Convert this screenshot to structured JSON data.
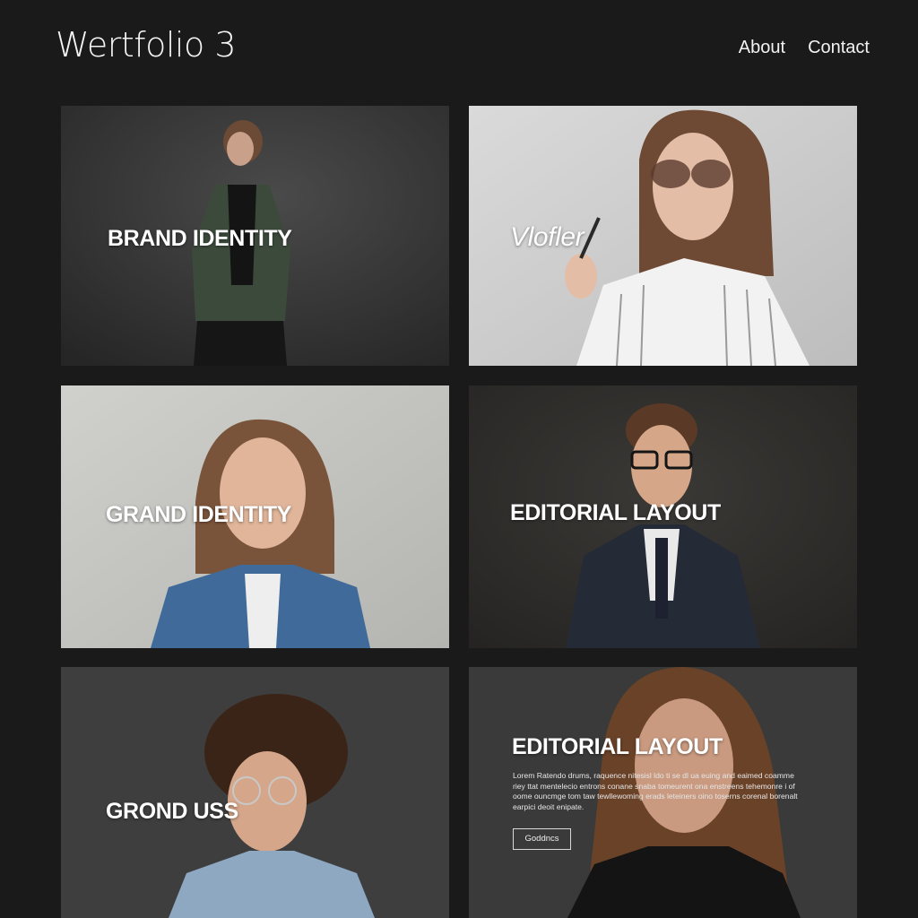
{
  "header": {
    "brand": "Wertfolio 3",
    "nav": {
      "about": "About",
      "contact": "Contact"
    }
  },
  "projects": [
    {
      "label": "BRAND IDENTITY"
    },
    {
      "label": "Vlofler"
    },
    {
      "label": "GRAND IDENTITY"
    },
    {
      "label": "EDITORIAL LAYOUT"
    },
    {
      "label": "GROND USS"
    },
    {
      "label": "EDITORIAL LAYOUT",
      "description": "Lorem Ratendo drums, raquence nitesisl ldo ti se dl ua euing and eaimed coamme riey ttat mentelecio entrons conane snaba tomeurent ona enstreens tehemonre i of oome ouncmge tom taw tewllewoming erads leteiners oino toserns corenal borenalt earpici deoit enipate.",
      "button": "Goddncs"
    }
  ],
  "colors": {
    "page_background": "#1a1a1a",
    "text": "#f2f2f2"
  }
}
